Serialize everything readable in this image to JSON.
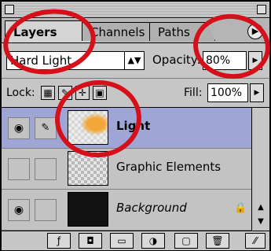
{
  "tabs": [
    {
      "label": "Layers",
      "active": true
    },
    {
      "label": "Channels",
      "active": false
    },
    {
      "label": "Paths",
      "active": false
    }
  ],
  "panel_menu_icon": "panel-menu-icon",
  "blend": {
    "mode": "Hard Light",
    "opacity_label": "Opacity:",
    "opacity_value": "80%"
  },
  "lock": {
    "label": "Lock:",
    "fill_label": "Fill:",
    "fill_value": "100%",
    "icons": [
      "lock-transparent-icon",
      "lock-image-icon",
      "lock-position-icon",
      "lock-all-icon"
    ]
  },
  "layers": [
    {
      "name": "Light",
      "visible": true,
      "selected": true,
      "style": "bold",
      "thumbnail": "orange-light-on-transparent"
    },
    {
      "name": "Graphic Elements",
      "visible": false,
      "selected": false,
      "style": "normal",
      "thumbnail": "transparent"
    },
    {
      "name": "Background",
      "visible": true,
      "selected": false,
      "style": "italic",
      "thumbnail": "black",
      "locked": true
    }
  ],
  "bottom_toolbar": [
    "layer-style-icon",
    "layer-mask-icon",
    "new-set-icon",
    "adjustment-layer-icon",
    "new-layer-icon",
    "trash-icon"
  ],
  "annotation_color": "#d4101a"
}
